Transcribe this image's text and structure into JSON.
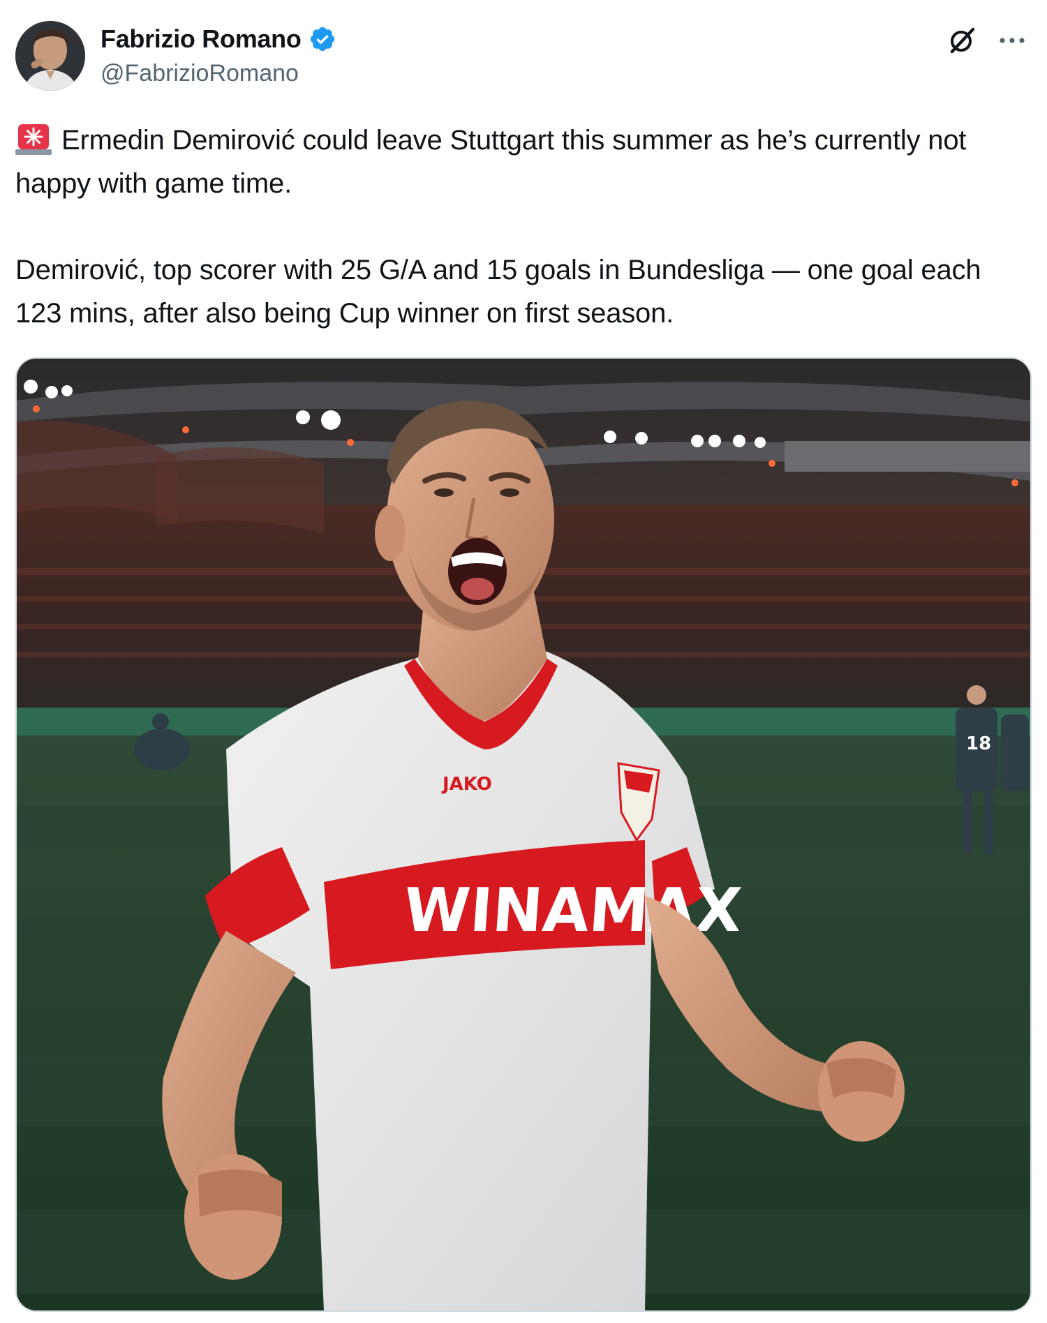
{
  "author": {
    "display_name": "Fabrizio Romano",
    "handle": "@FabrizioRomano",
    "verified": true,
    "avatar_icon": "profile-photo"
  },
  "actions": {
    "grok_icon": "grok-icon",
    "more_icon": "more-options-icon"
  },
  "tweet": {
    "emoji": "siren-icon",
    "paragraph1": "Ermedin Demirović could leave Stuttgart this summer as he’s currently not happy with game time.",
    "paragraph2": "Demirović, top scorer with 25 G/A and 15 goals in Bundesliga — one goal each 123 mins, after also being Cup winner on first season."
  },
  "media": {
    "type": "photo",
    "jersey_brand": "JAKO",
    "jersey_sponsor": "WINAMAX",
    "background_player_number": "18"
  },
  "colors": {
    "verified_blue": "#1d9bf0",
    "text_primary": "#0f1419",
    "text_secondary": "#536471",
    "stuttgart_red": "#d71920"
  }
}
